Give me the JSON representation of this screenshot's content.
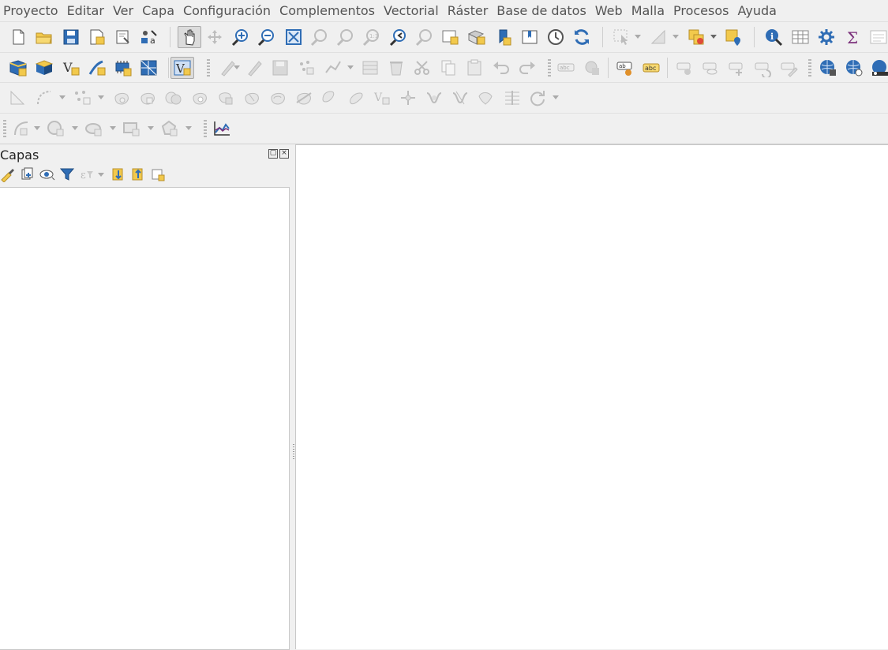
{
  "menubar": {
    "items": [
      "Proyecto",
      "Editar",
      "Ver",
      "Capa",
      "Configuración",
      "Complementos",
      "Vectorial",
      "Ráster",
      "Base de datos",
      "Web",
      "Malla",
      "Procesos",
      "Ayuda"
    ]
  },
  "layers_panel": {
    "title": "Capas"
  },
  "colors": {
    "accent_blue": "#2f6db5",
    "folder_yellow": "#f2c94c",
    "disabled_gray": "#bdbdbd",
    "canvas_bg": "#ffffff"
  }
}
